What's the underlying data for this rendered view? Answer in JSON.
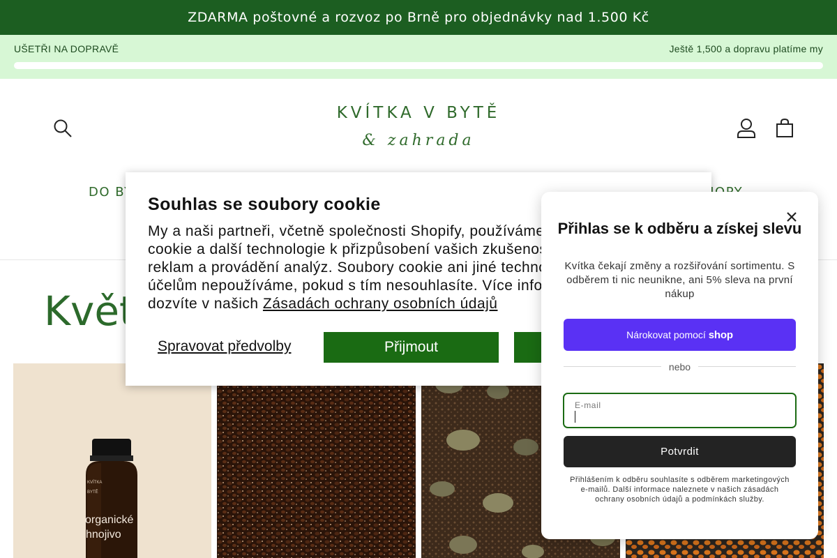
{
  "announcement": "ZDARMA poštovné a rozvoz po Brně pro objednávky nad 1.500 Kč",
  "shipping_bar": {
    "left_text": "UŠETŘI NA DOPRAVĚ ",
    "right_text": "Ještě 1,500 a dopravu platíme my ",
    "progress": 0
  },
  "header": {
    "logo_line1": "KVÍTKA V BYTĚ",
    "logo_line2": "& zahrada",
    "nav_left_partial": "DO BY",
    "nav_right_partial": "HOPY"
  },
  "main": {
    "title_partial": "Květ"
  },
  "products": [
    {
      "label_line1": "organické",
      "label_line2": "hnojivo",
      "jar_top": "KVÍTKA",
      "jar_sub": "BYTĚ"
    },
    {},
    {},
    {}
  ],
  "cookie_banner": {
    "title": "Souhlas se soubory cookie",
    "text_line1": "My a naši partneři, včetně společnosti Shopify, používáme soubory",
    "text_line2": "cookie a další technologie k přizpůsobení vašich zkušeností, zobrazování",
    "text_line3": "reklam a provádění analýz. Soubory cookie ani jiné technologie k těmto",
    "text_line4": "účelům nepoužíváme, pokud s tím nesouhlasíte. Více informací se",
    "text_line5_prefix": "dozvíte v našich ",
    "link": "Zásadách ochrany osobních údajů",
    "manage": "Spravovat předvolby",
    "accept": "Přijmout"
  },
  "newsletter": {
    "title": "Přihlas se k odběru a získej slevu",
    "description": "Kvítka čekají změny a rozšiřování sortimentu. S odběrem ti nic neunikne, ani 5% sleva na první nákup",
    "shop_button_prefix": "Nárokovat pomocí",
    "shop_button_brand": "shop",
    "or": "nebo",
    "email_label": "E-mail",
    "email_value": "",
    "submit": "Potvrdit",
    "legal": "Přihlášením k odběru souhlasíte s odběrem marketingových e-mailů. Další informace naleznete v našich zásadách ochrany osobních údajů a podmínkách služby."
  }
}
